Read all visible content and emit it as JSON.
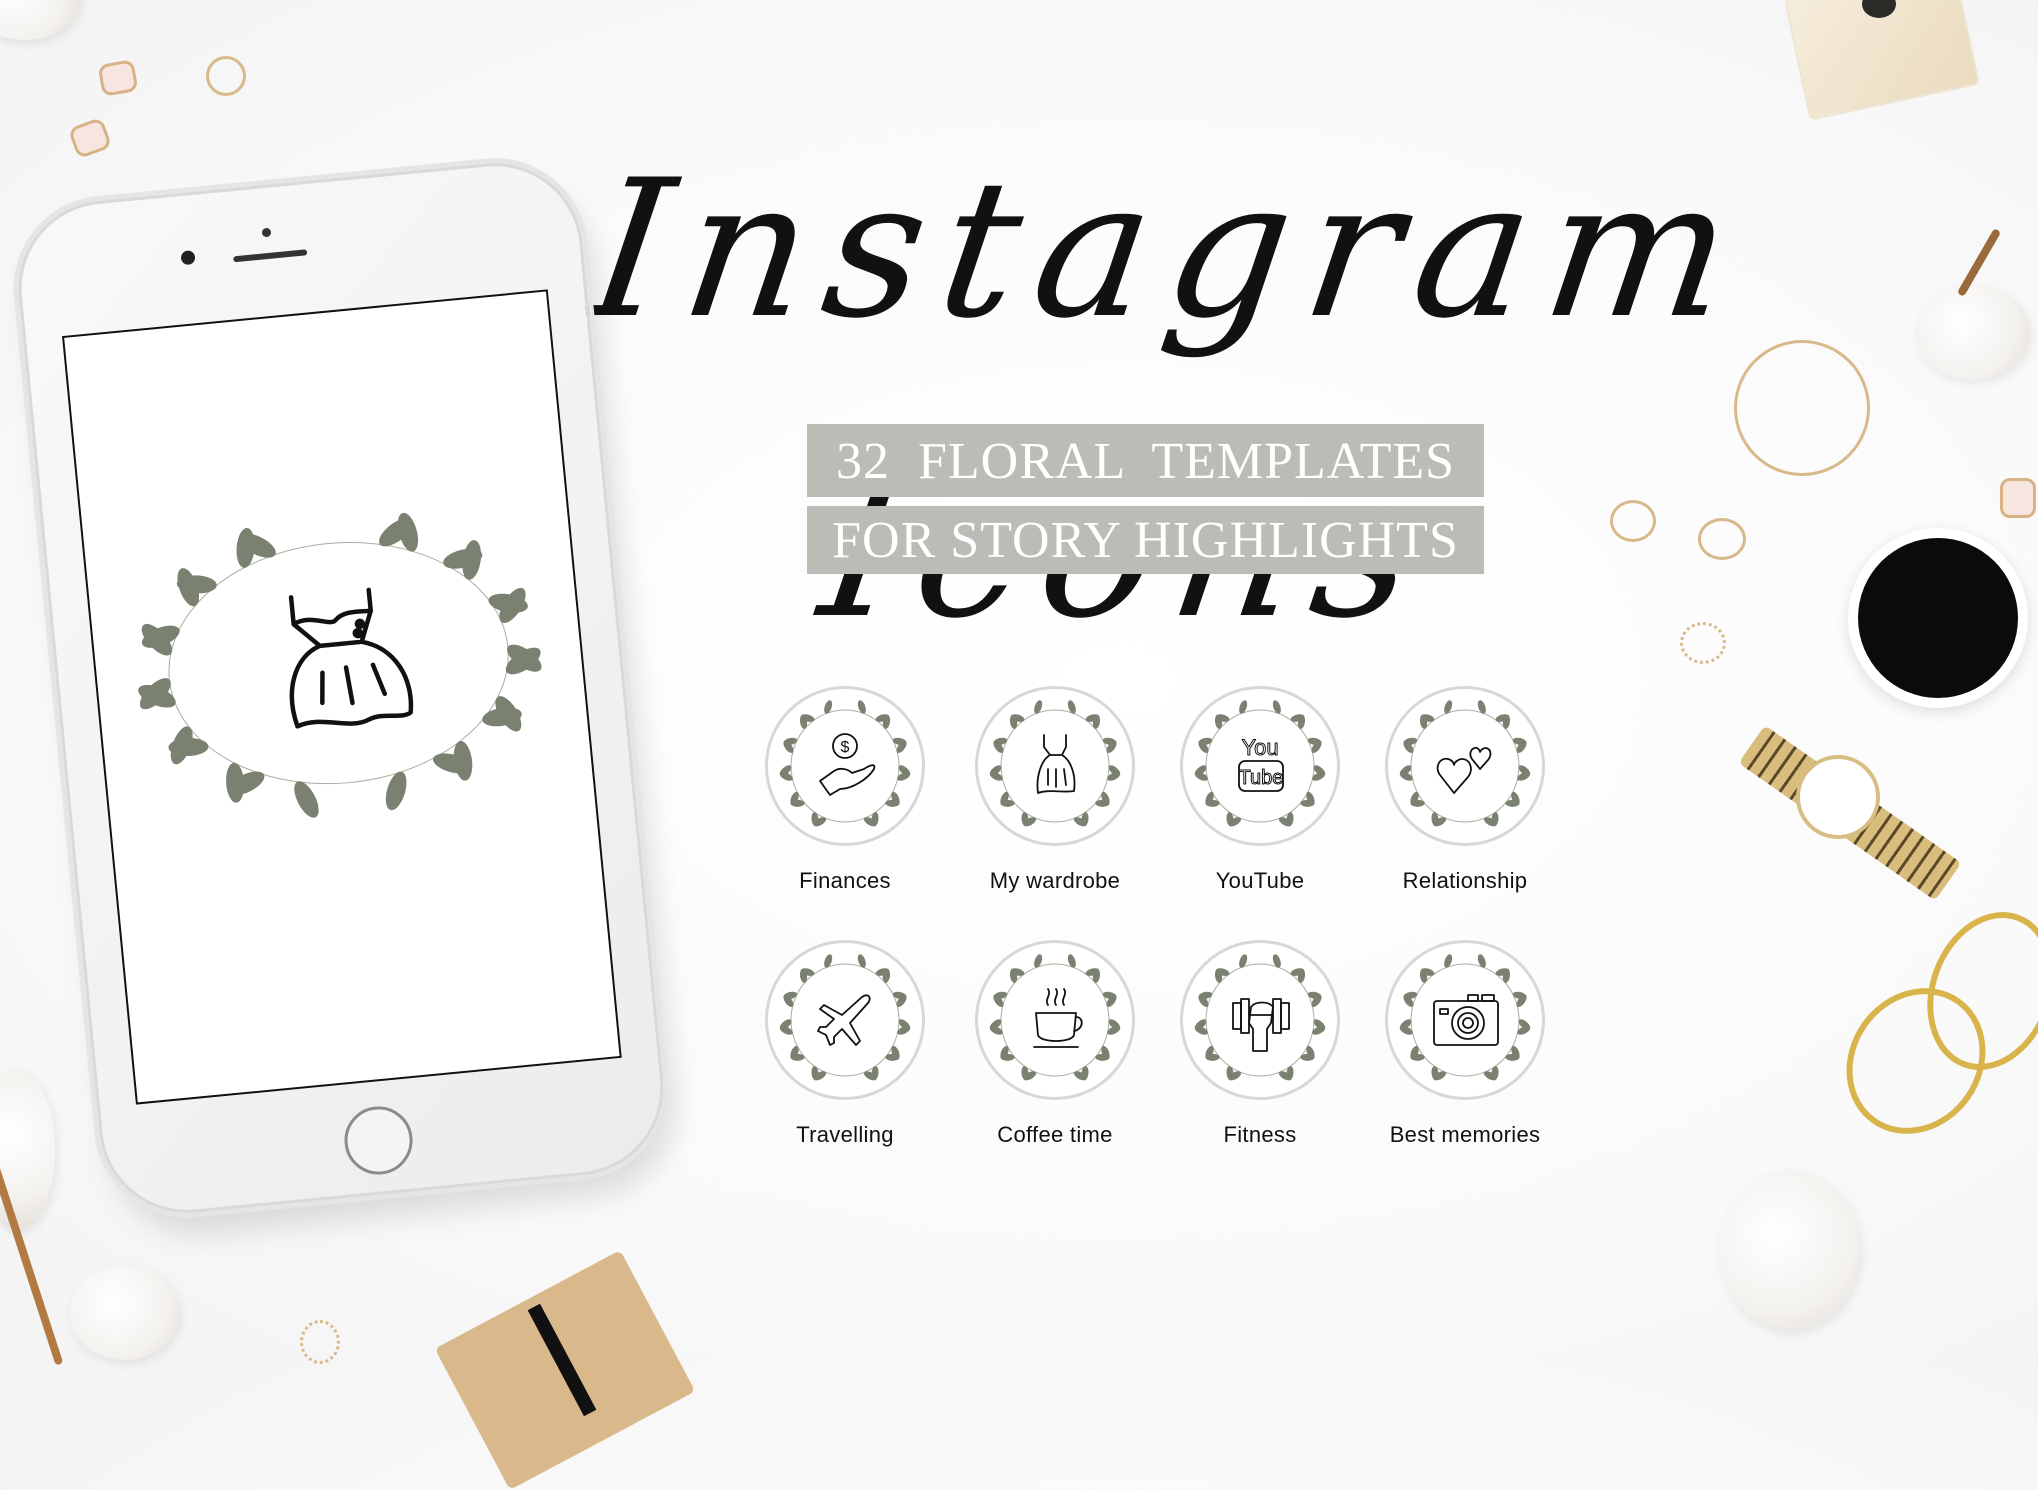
{
  "title": "Instagram Icons",
  "banner": {
    "line1": "32  FLORAL  TEMPLATES",
    "line2": "FOR STORY HIGHLIGHTS"
  },
  "colors": {
    "banner_bg": "#b9bdb5",
    "banner_text": "#ffffff",
    "leaf_green": "#7a8170",
    "icon_stroke": "#111111",
    "circle_border": "#d7d7d7",
    "gold": "#d8b98a",
    "coffee": "#0b0b0b"
  },
  "phone": {
    "screen_icon": "dress-icon",
    "wreath": "olive-wreath"
  },
  "highlights": [
    {
      "label": "Finances",
      "icon": "money-hand-icon"
    },
    {
      "label": "My wardrobe",
      "icon": "dress-icon"
    },
    {
      "label": "YouTube",
      "icon": "youtube-text-icon"
    },
    {
      "label": "Relationship",
      "icon": "hearts-icon"
    },
    {
      "label": "Travelling",
      "icon": "airplane-icon"
    },
    {
      "label": "Coffee time",
      "icon": "coffee-cup-icon"
    },
    {
      "label": "Fitness",
      "icon": "dumbbell-fist-icon"
    },
    {
      "label": "Best memories",
      "icon": "camera-icon"
    }
  ],
  "youtube_glyph": {
    "top": "You",
    "bottom": "Tube"
  },
  "finance_glyph": "$",
  "decor": [
    "cotton-flowers",
    "gold-rings",
    "earrings",
    "perfume-bottle",
    "gold-bracelet",
    "coffee-cup",
    "gold-watch",
    "gold-scissors",
    "kraft-notebook"
  ]
}
